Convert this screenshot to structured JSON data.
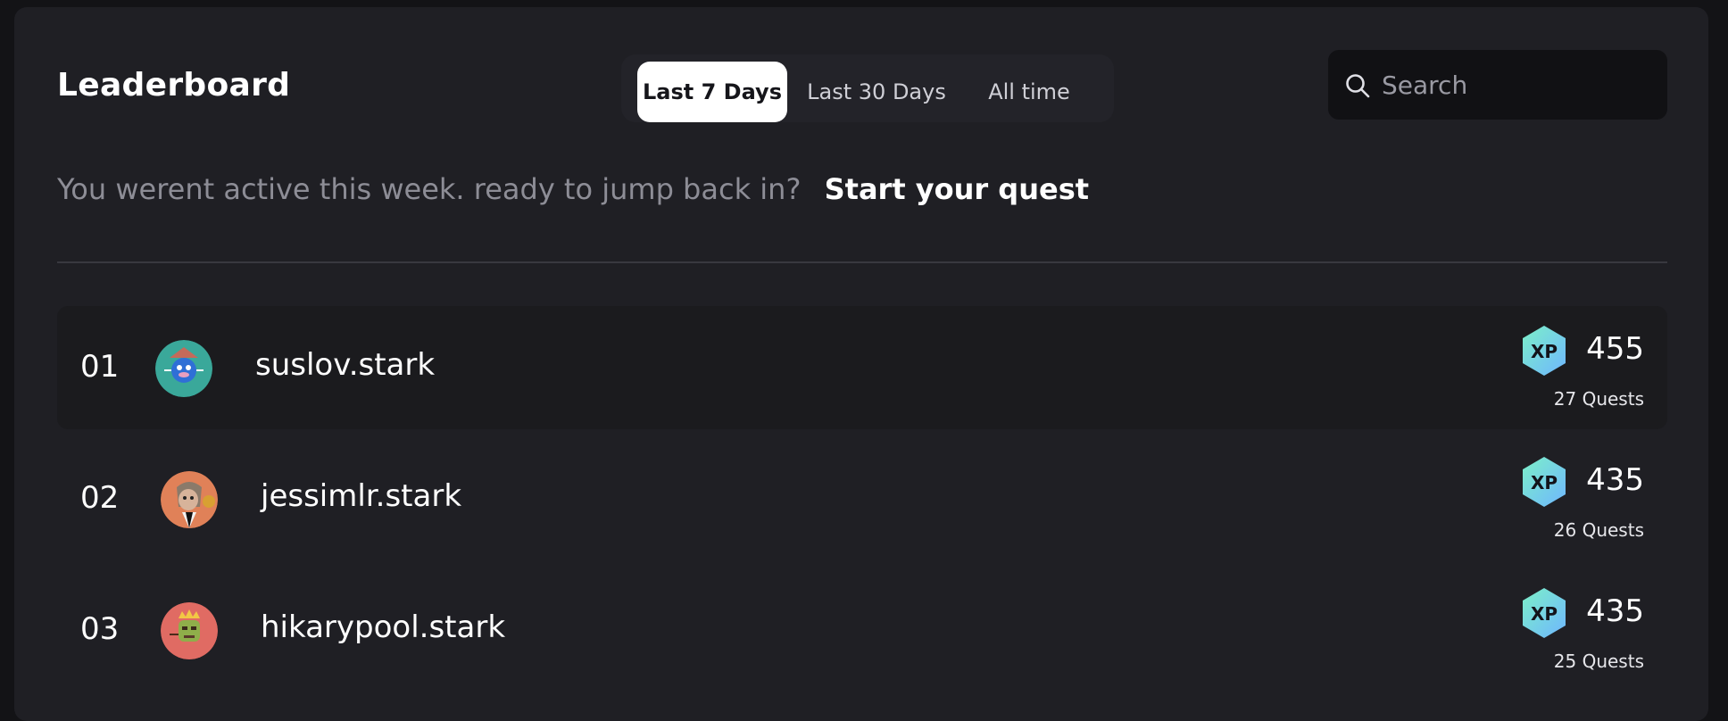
{
  "header": {
    "title": "Leaderboard",
    "tabs": [
      {
        "label": "Last 7 Days",
        "active": true
      },
      {
        "label": "Last 30 Days",
        "active": false
      },
      {
        "label": "All time",
        "active": false
      }
    ],
    "search": {
      "placeholder": "Search",
      "value": "",
      "icon": "search-icon"
    }
  },
  "notice": {
    "text": "You werent active this week. ready to jump back in?",
    "cta": "Start your quest"
  },
  "leaderboard": {
    "xp_badge_label": "XP",
    "rows": [
      {
        "rank": "01",
        "name": "suslov.stark",
        "xp": "455",
        "quests": "27 Quests",
        "avatar_color": "#3aa89a"
      },
      {
        "rank": "02",
        "name": "jessimlr.stark",
        "xp": "435",
        "quests": "26 Quests",
        "avatar_color": "#e08158"
      },
      {
        "rank": "03",
        "name": "hikarypool.stark",
        "xp": "435",
        "quests": "25 Quests",
        "avatar_color": "#e06b63"
      }
    ]
  },
  "colors": {
    "background": "#131316",
    "panel": "#1f1f24",
    "active_tab": "#ffffff",
    "xp_gradient_start": "#7cf0c8",
    "xp_gradient_end": "#6fb6ff"
  }
}
